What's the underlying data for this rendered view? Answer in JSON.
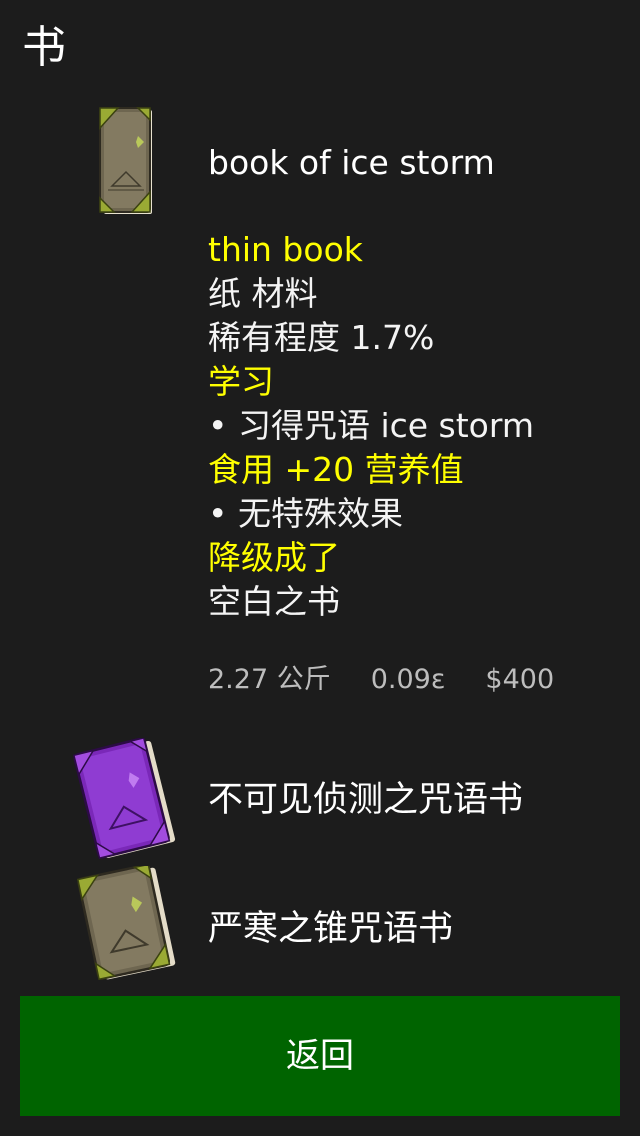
{
  "header": {
    "title": "书"
  },
  "selected_item": {
    "name": "book of ice storm",
    "icon": "brown-spellbook-icon",
    "details": [
      {
        "text": "thin book",
        "color": "#ffff00"
      },
      {
        "text": "纸 材料",
        "color": "#f4f4f4"
      },
      {
        "text": "稀有程度 1.7%",
        "color": "#f4f4f4"
      },
      {
        "text": "学习",
        "color": "#ffff00"
      },
      {
        "text": "• 习得咒语 ice storm",
        "color": "#f4f4f4"
      },
      {
        "text": "食用 +20 营养值",
        "color": "#ffff00"
      },
      {
        "text": "• 无特殊效果",
        "color": "#f4f4f4"
      },
      {
        "text": "降级成了",
        "color": "#ffff00"
      },
      {
        "text": "空白之书",
        "color": "#f4f4f4"
      }
    ],
    "weight": "2.27 公斤",
    "energy": "0.09ε",
    "price": "$400"
  },
  "items": [
    {
      "name": "不可见侦测之咒语书",
      "icon": "purple-spellbook-icon"
    },
    {
      "name": "严寒之锥咒语书",
      "icon": "brown-spellbook-icon"
    }
  ],
  "footer": {
    "back_label": "返回"
  },
  "colors": {
    "background": "#1c1c1c",
    "highlight": "#ffff00",
    "button": "#006400"
  }
}
